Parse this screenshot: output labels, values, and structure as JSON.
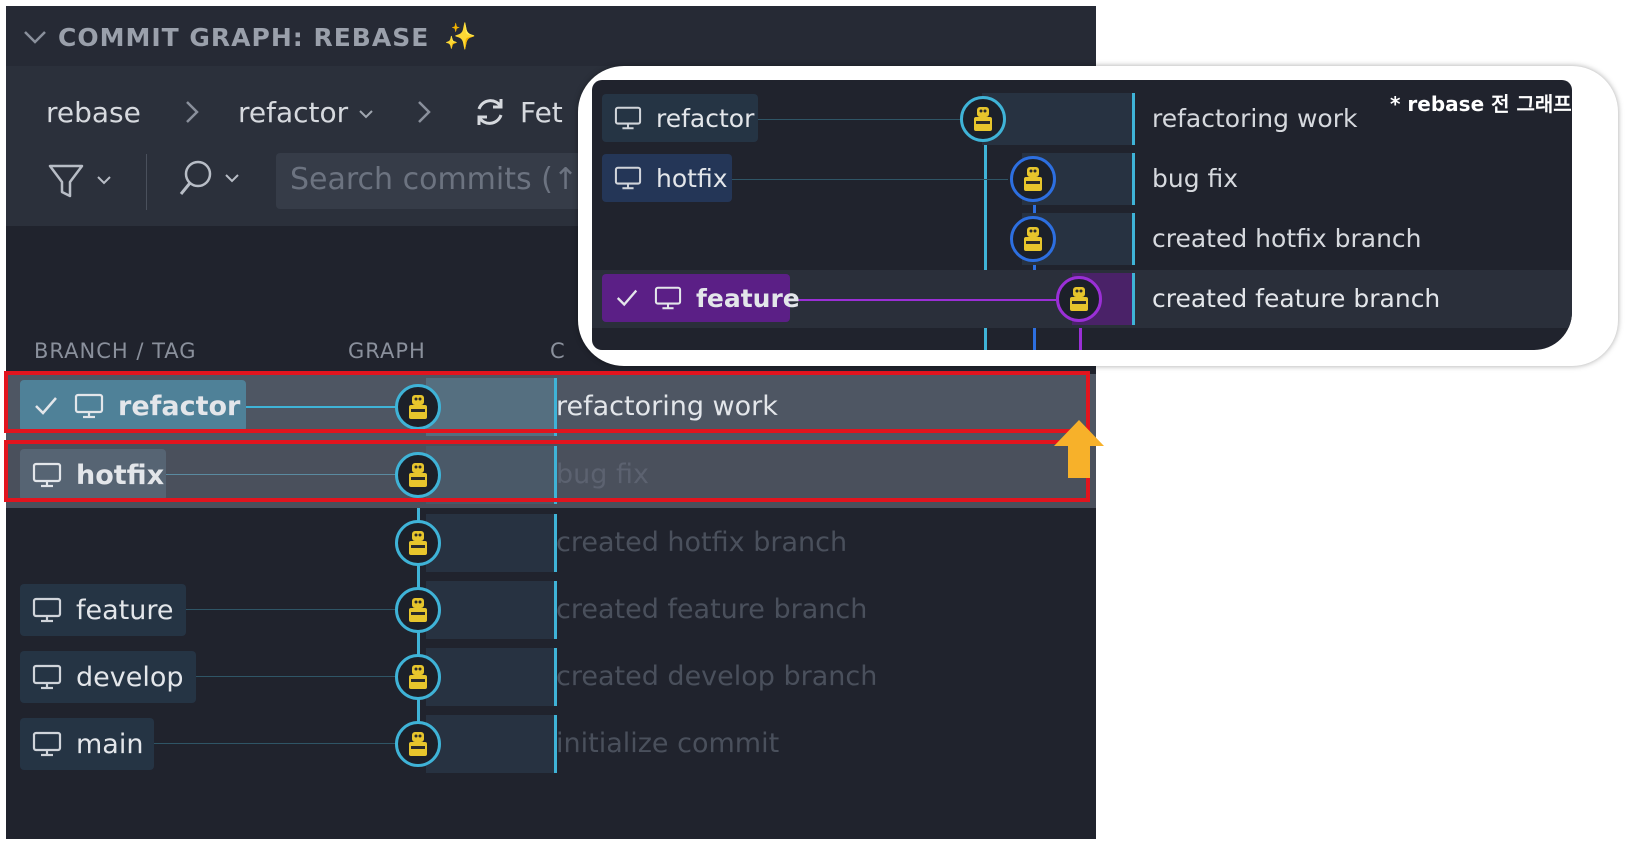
{
  "panel": {
    "title": "COMMIT GRAPH: REBASE",
    "title_icon": "sparkles-icon"
  },
  "toolbar": {
    "breadcrumb": [
      {
        "label": "rebase"
      },
      {
        "label": "refactor"
      },
      {
        "label": "Fet"
      }
    ],
    "search_placeholder": "Search commits (↑"
  },
  "columns": {
    "branch_tag": "BRANCH / TAG",
    "graph": "GRAPH",
    "commit": "C"
  },
  "rows": [
    {
      "branch": "refactor",
      "checked": true,
      "message": "refactoring work",
      "dim": false
    },
    {
      "branch": "hotfix",
      "checked": false,
      "message": "bug fix",
      "dim": true
    },
    {
      "branch": "",
      "checked": false,
      "message": "created hotfix branch",
      "dim": true
    },
    {
      "branch": "feature",
      "checked": false,
      "message": "created feature branch",
      "dim": true
    },
    {
      "branch": "develop",
      "checked": false,
      "message": "created develop branch",
      "dim": true
    },
    {
      "branch": "main",
      "checked": false,
      "message": "initialize commit",
      "dim": true
    }
  ],
  "inset": {
    "note": "* rebase 전 그래프",
    "rows": [
      {
        "branch": "refactor",
        "checked": false,
        "message": "refactoring work"
      },
      {
        "branch": "hotfix",
        "checked": false,
        "message": "bug fix"
      },
      {
        "branch": "",
        "checked": false,
        "message": "created hotfix branch"
      },
      {
        "branch": "feature",
        "checked": true,
        "message": "created feature branch"
      }
    ]
  },
  "colors": {
    "graph_line": "#3fb3d7",
    "hotfix_line": "#2d6fe0",
    "feature_line": "#9a2fd6",
    "highlight_border": "#e2141e",
    "arrow": "#f7b12a"
  }
}
